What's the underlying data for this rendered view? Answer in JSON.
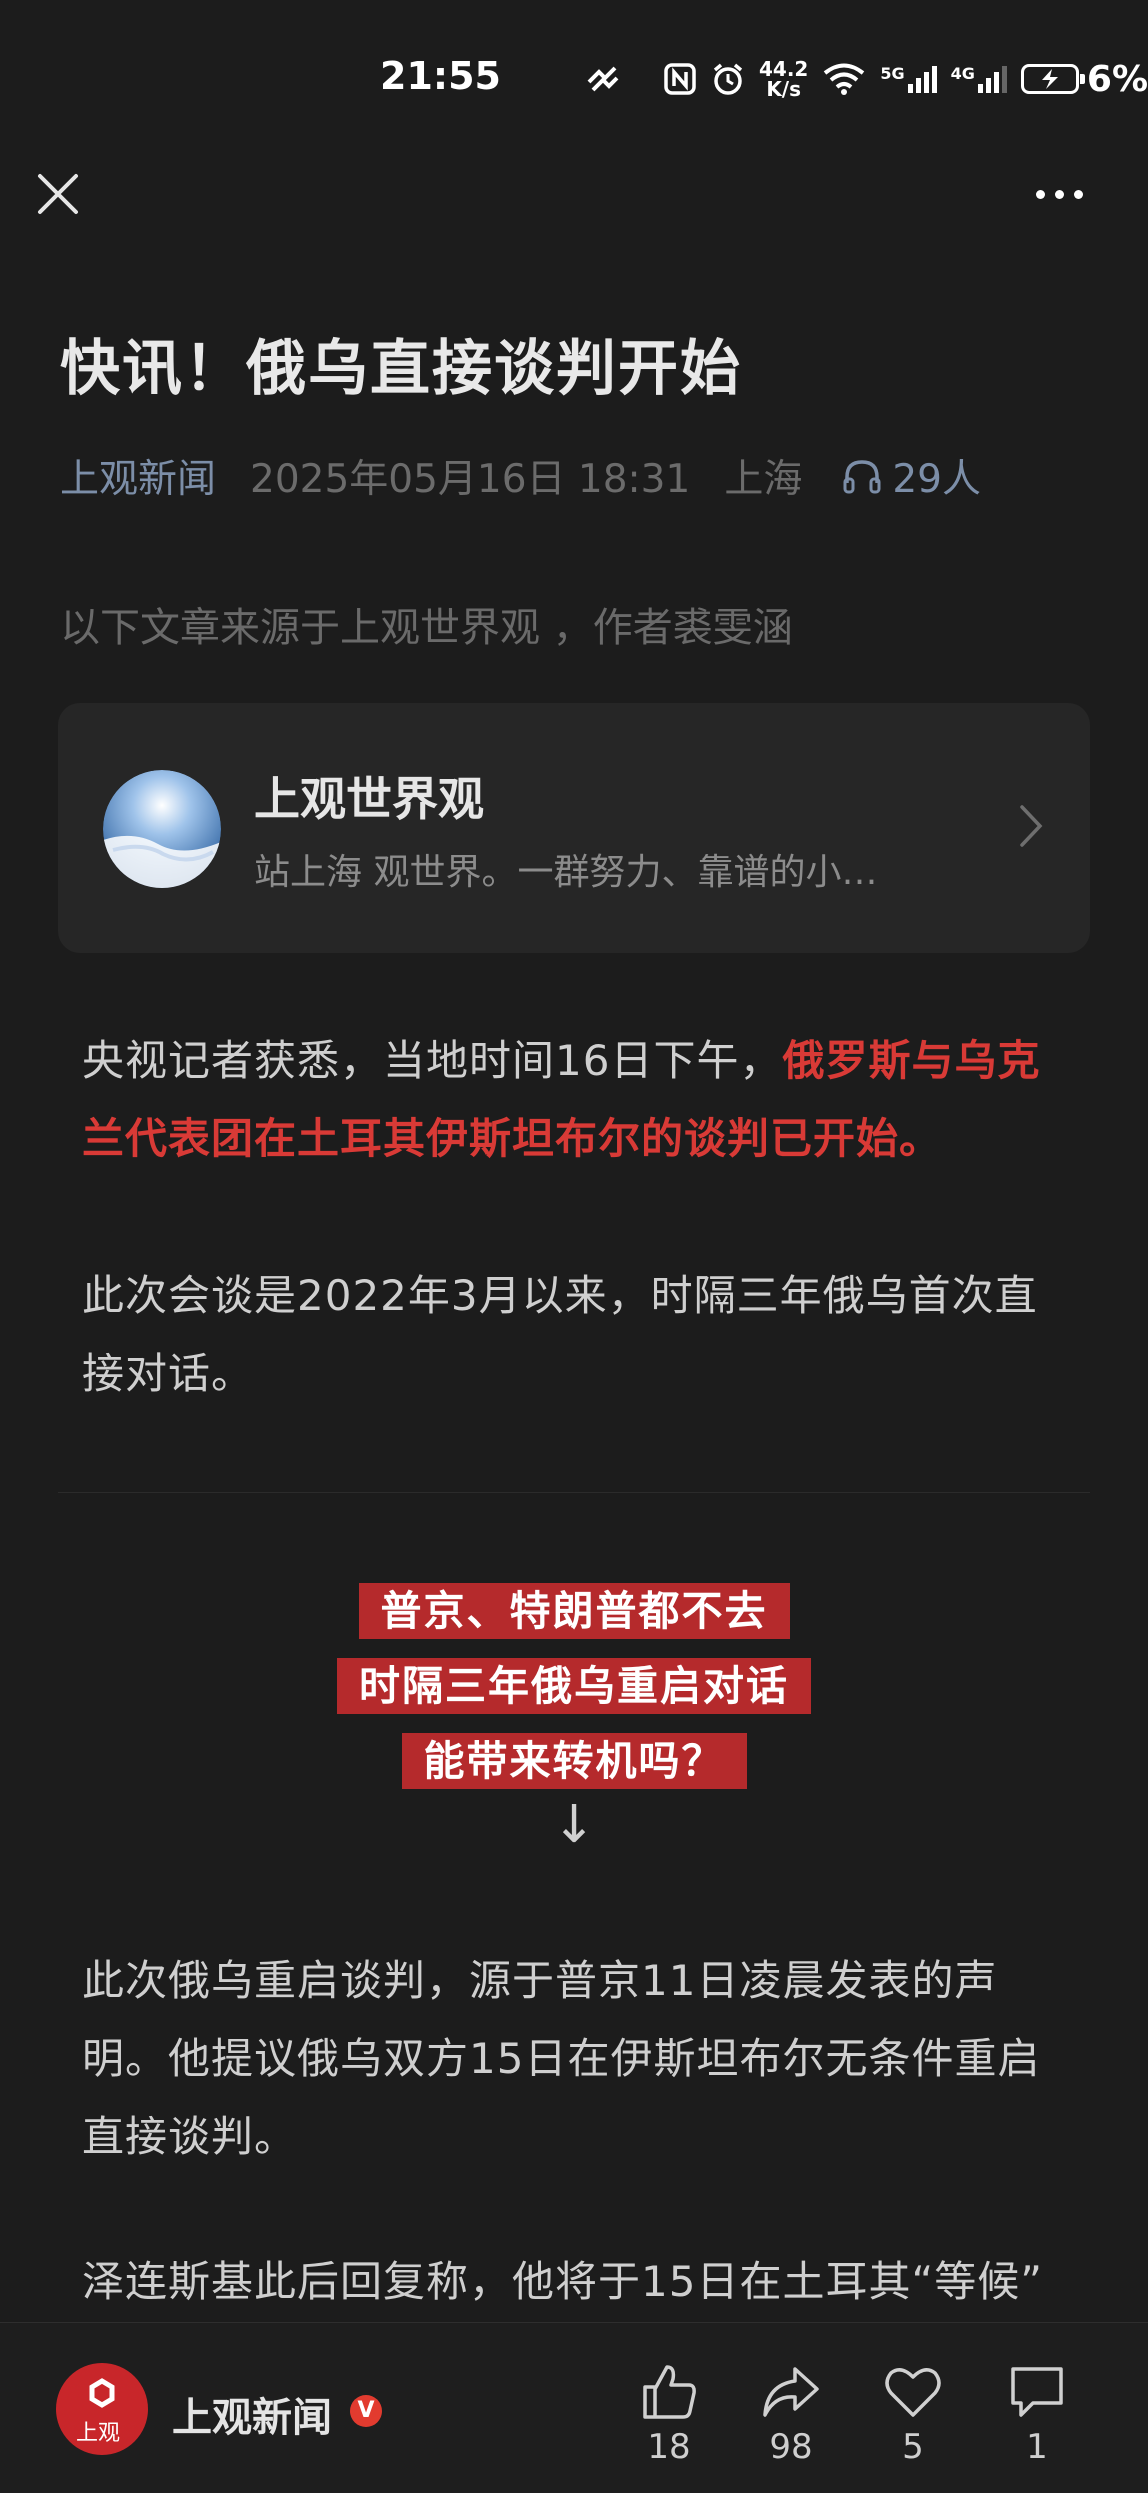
{
  "status_bar": {
    "time": "21:55",
    "net_speed_value": "44.2",
    "net_speed_unit": "K/s",
    "signal_1": "5G",
    "signal_2": "4G",
    "battery": "6%"
  },
  "article": {
    "title": "快讯！俄乌直接谈判开始",
    "source": "上观新闻",
    "date": "2025年05月16日 18:31",
    "location": "上海",
    "listeners": "29人",
    "source_note": "以下文章来源于上观世界观 ，作者裘雯涵",
    "paragraph1_normal": "央视记者获悉，当地时间16日下午，",
    "paragraph1_highlight": "俄罗斯与乌克兰代表团在土耳其伊斯坦布尔的谈判已开始。",
    "paragraph2": "此次会谈是2022年3月以来，时隔三年俄乌首次直接对话。",
    "banner_lines": [
      "普京、特朗普都不去",
      "时隔三年俄乌重启对话",
      "能带来转机吗？"
    ],
    "arrow": "↓",
    "paragraph3": "此次俄乌重启谈判，源于普京11日凌晨发表的声明。他提议俄乌双方15日在伊斯坦布尔无条件重启直接谈判。",
    "paragraph4": "泽连斯基此后回复称，他将于15日在土耳其“等候”"
  },
  "account_card": {
    "name": "上观世界观",
    "description": "站上海 观世界。一群努力、靠谱的小…"
  },
  "bottom_bar": {
    "publisher": "上观新闻",
    "logo_text": "上观",
    "verified_badge": "V",
    "likes": "18",
    "shares": "98",
    "favorites": "5",
    "comments": "1"
  },
  "colors": {
    "background": "#1c1c1c",
    "highlight_red": "#d93a36",
    "banner_red": "#b52a2c",
    "link_blue": "#7c8ea8"
  }
}
